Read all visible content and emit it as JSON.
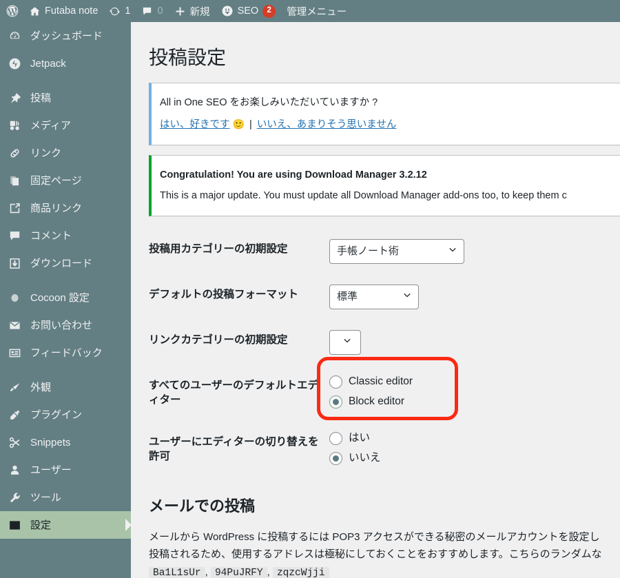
{
  "adminbar": {
    "wp_logo": "wordpress-logo-icon",
    "site_name": "Futaba note",
    "updates_count": "1",
    "comments_count": "0",
    "new_label": "新規",
    "seo_label": "SEO",
    "seo_badge": "2",
    "admin_menu_label": "管理メニュー"
  },
  "sidebar": {
    "items": [
      {
        "label": "ダッシュボード",
        "icon": "dashboard-icon",
        "current": false
      },
      {
        "label": "Jetpack",
        "icon": "jetpack-icon",
        "current": false
      },
      {
        "label": "投稿",
        "icon": "pin-icon",
        "current": false
      },
      {
        "label": "メディア",
        "icon": "media-icon",
        "current": false
      },
      {
        "label": "リンク",
        "icon": "link-icon",
        "current": false
      },
      {
        "label": "固定ページ",
        "icon": "pages-icon",
        "current": false
      },
      {
        "label": "商品リンク",
        "icon": "external-link-icon",
        "current": false
      },
      {
        "label": "コメント",
        "icon": "comment-icon",
        "current": false
      },
      {
        "label": "ダウンロード",
        "icon": "download-icon",
        "current": false
      },
      {
        "label": "Cocoon 設定",
        "icon": "circle-icon",
        "current": false
      },
      {
        "label": "お問い合わせ",
        "icon": "mail-icon",
        "current": false
      },
      {
        "label": "フィードバック",
        "icon": "feedback-icon",
        "current": false
      },
      {
        "label": "外観",
        "icon": "brush-icon",
        "current": false
      },
      {
        "label": "プラグイン",
        "icon": "plug-icon",
        "current": false
      },
      {
        "label": "Snippets",
        "icon": "scissors-icon",
        "current": false
      },
      {
        "label": "ユーザー",
        "icon": "user-icon",
        "current": false
      },
      {
        "label": "ツール",
        "icon": "wrench-icon",
        "current": false
      },
      {
        "label": "設定",
        "icon": "settings-icon",
        "current": true
      }
    ]
  },
  "page": {
    "title": "投稿設定"
  },
  "notices": {
    "aioseo": {
      "text": "All in One SEO をお楽しみいただいていますか ?",
      "yes_link": "はい、好きです",
      "emoji": "🙂",
      "separator": "|",
      "no_link": "いいえ、あまりそう思いません"
    },
    "download_manager": {
      "title": "Congratulation! You are using Download Manager 3.2.12",
      "body": "This is a major update. You must update all Download Manager add-ons too, to keep them c"
    }
  },
  "form": {
    "rows": {
      "default_category": {
        "label": "投稿用カテゴリーの初期設定",
        "value": "手帳ノート術"
      },
      "default_post_format": {
        "label": "デフォルトの投稿フォーマット",
        "value": "標準"
      },
      "default_link_category": {
        "label": "リンクカテゴリーの初期設定",
        "value": ""
      },
      "default_editor": {
        "label": "すべてのユーザーのデフォルトエディター",
        "options": [
          {
            "label": "Classic editor",
            "checked": false
          },
          {
            "label": "Block editor",
            "checked": true
          }
        ]
      },
      "allow_switch": {
        "label": "ユーザーにエディターの切り替えを許可",
        "options": [
          {
            "label": "はい",
            "checked": false
          },
          {
            "label": "いいえ",
            "checked": true
          }
        ]
      }
    }
  },
  "mail_section": {
    "title": "メールでの投稿",
    "line1": "メールから WordPress に投稿するには POP3 アクセスができる秘密のメールアカウントを設定し",
    "line2": "投稿されるため、使用するアドレスは極秘にしておくことをおすすめします。こちらのランダムな",
    "codes": [
      "Ba1L1sUr",
      "94PuJRFY",
      "zqzcWjji"
    ],
    "code_separator": ","
  },
  "colors": {
    "admin_chrome": "#637f84",
    "current_menu_bg": "#a8c3a8",
    "content_bg": "#f0f0f1",
    "notice_info": "#72aee6",
    "notice_success": "#00a32a",
    "link": "#2271b1",
    "badge": "#d63c27",
    "highlight": "#fb2a14"
  }
}
